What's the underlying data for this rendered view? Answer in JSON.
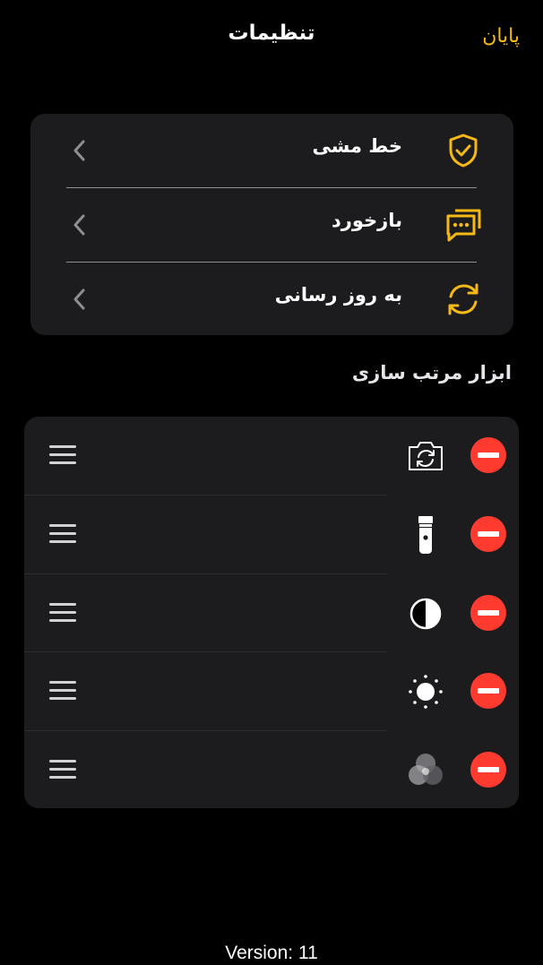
{
  "header": {
    "title": "تنظیمات",
    "done_label": "پایان"
  },
  "settings": {
    "items": [
      {
        "label": "خط مشی",
        "icon": "shield-check-icon"
      },
      {
        "label": "بازخورد",
        "icon": "feedback-chat-icon"
      },
      {
        "label": "به روز رسانی",
        "icon": "refresh-icon"
      }
    ]
  },
  "tools": {
    "section_title": "ابزار مرتب سازی",
    "items": [
      {
        "icon": "camera-flip-icon"
      },
      {
        "icon": "flashlight-icon"
      },
      {
        "icon": "contrast-icon"
      },
      {
        "icon": "brightness-icon"
      },
      {
        "icon": "color-filter-icon"
      }
    ]
  },
  "footer": {
    "version": "Version: 11"
  },
  "colors": {
    "accent": "#f5b916",
    "background": "#000000",
    "card": "#1c1c1e",
    "remove": "#ff3b30"
  }
}
